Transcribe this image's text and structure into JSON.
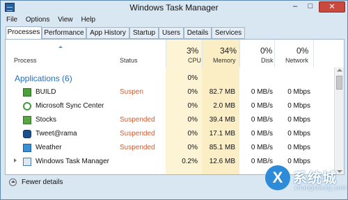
{
  "window": {
    "title": "Windows Task Manager",
    "minimize": "–",
    "maximize": "□",
    "close": "✕"
  },
  "menu": [
    "File",
    "Options",
    "View",
    "Help"
  ],
  "tabs": [
    "Processes",
    "Performance",
    "App History",
    "Startup",
    "Users",
    "Details",
    "Services"
  ],
  "active_tab": "Processes",
  "columns": {
    "process": "Process",
    "status": "Status",
    "cpu": {
      "label": "CPU",
      "pct": "3%"
    },
    "memory": {
      "label": "Memory",
      "pct": "34%"
    },
    "disk": {
      "label": "Disk",
      "pct": "0%"
    },
    "network": {
      "label": "Network",
      "pct": "0%"
    }
  },
  "group": {
    "name": "Applications (6)",
    "cpu": "0%"
  },
  "rows": [
    {
      "name": "BUILD",
      "status": "Suspen",
      "cpu": "0%",
      "memory": "82.7 MB",
      "disk": "0 MB/s",
      "network": "0 Mbps",
      "icon": "build-icon"
    },
    {
      "name": "Microsoft Sync Center",
      "status": "",
      "cpu": "0%",
      "memory": "2.0 MB",
      "disk": "0 MB/s",
      "network": "0 Mbps",
      "icon": "sync-icon"
    },
    {
      "name": "Stocks",
      "status": "Suspended",
      "cpu": "0%",
      "memory": "39.4 MB",
      "disk": "0 MB/s",
      "network": "0 Mbps",
      "icon": "stocks-icon"
    },
    {
      "name": "Tweet@rama",
      "status": "Suspended",
      "cpu": "0%",
      "memory": "17.1 MB",
      "disk": "0 MB/s",
      "network": "0 Mbps",
      "icon": "tweet-icon"
    },
    {
      "name": "Weather",
      "status": "Suspended",
      "cpu": "0%",
      "memory": "85.1 MB",
      "disk": "0 MB/s",
      "network": "0 Mbps",
      "icon": "weather-icon"
    },
    {
      "name": "Windows Task Manager",
      "status": "",
      "cpu": "0.2%",
      "memory": "12.6 MB",
      "disk": "0 MB/s",
      "network": "0 Mbps",
      "icon": "task-manager-icon"
    }
  ],
  "footer": {
    "fewer_details": "Fewer details"
  },
  "watermark": {
    "logo": "X",
    "text": "系统城",
    "sub": "xitongcheng.com"
  },
  "colors": {
    "status_suspended": "#d65a2c",
    "group_title": "#2a6ebb",
    "close_button": "#c9493e",
    "cpu_highlight": "#fdf4d6",
    "memory_highlight": "#fbeec4"
  }
}
